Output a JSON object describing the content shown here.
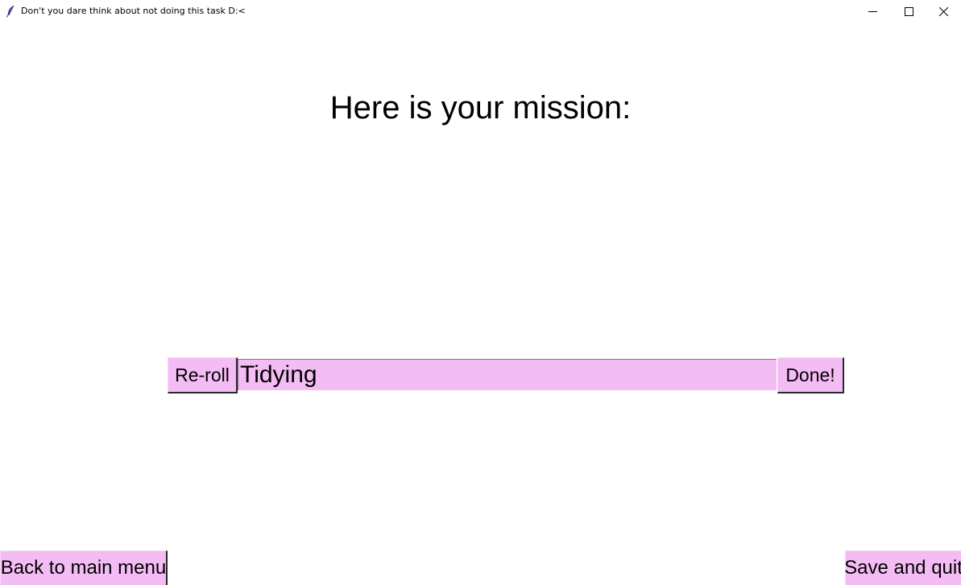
{
  "window": {
    "title": "Don't you dare think about not doing this task D:<",
    "icon": "feather-icon",
    "controls": [
      "minimize-icon",
      "maximize-icon",
      "close-icon"
    ]
  },
  "main": {
    "heading": "Here is your mission:",
    "reroll_label": "Re-roll",
    "task_value": "Tidying",
    "done_label": "Done!"
  },
  "footer": {
    "back_label": "Back to main menu",
    "save_label": "Save and quit"
  },
  "colors": {
    "button_bg": "#f4bcf4",
    "background": "#ffffff",
    "text": "#000000"
  }
}
